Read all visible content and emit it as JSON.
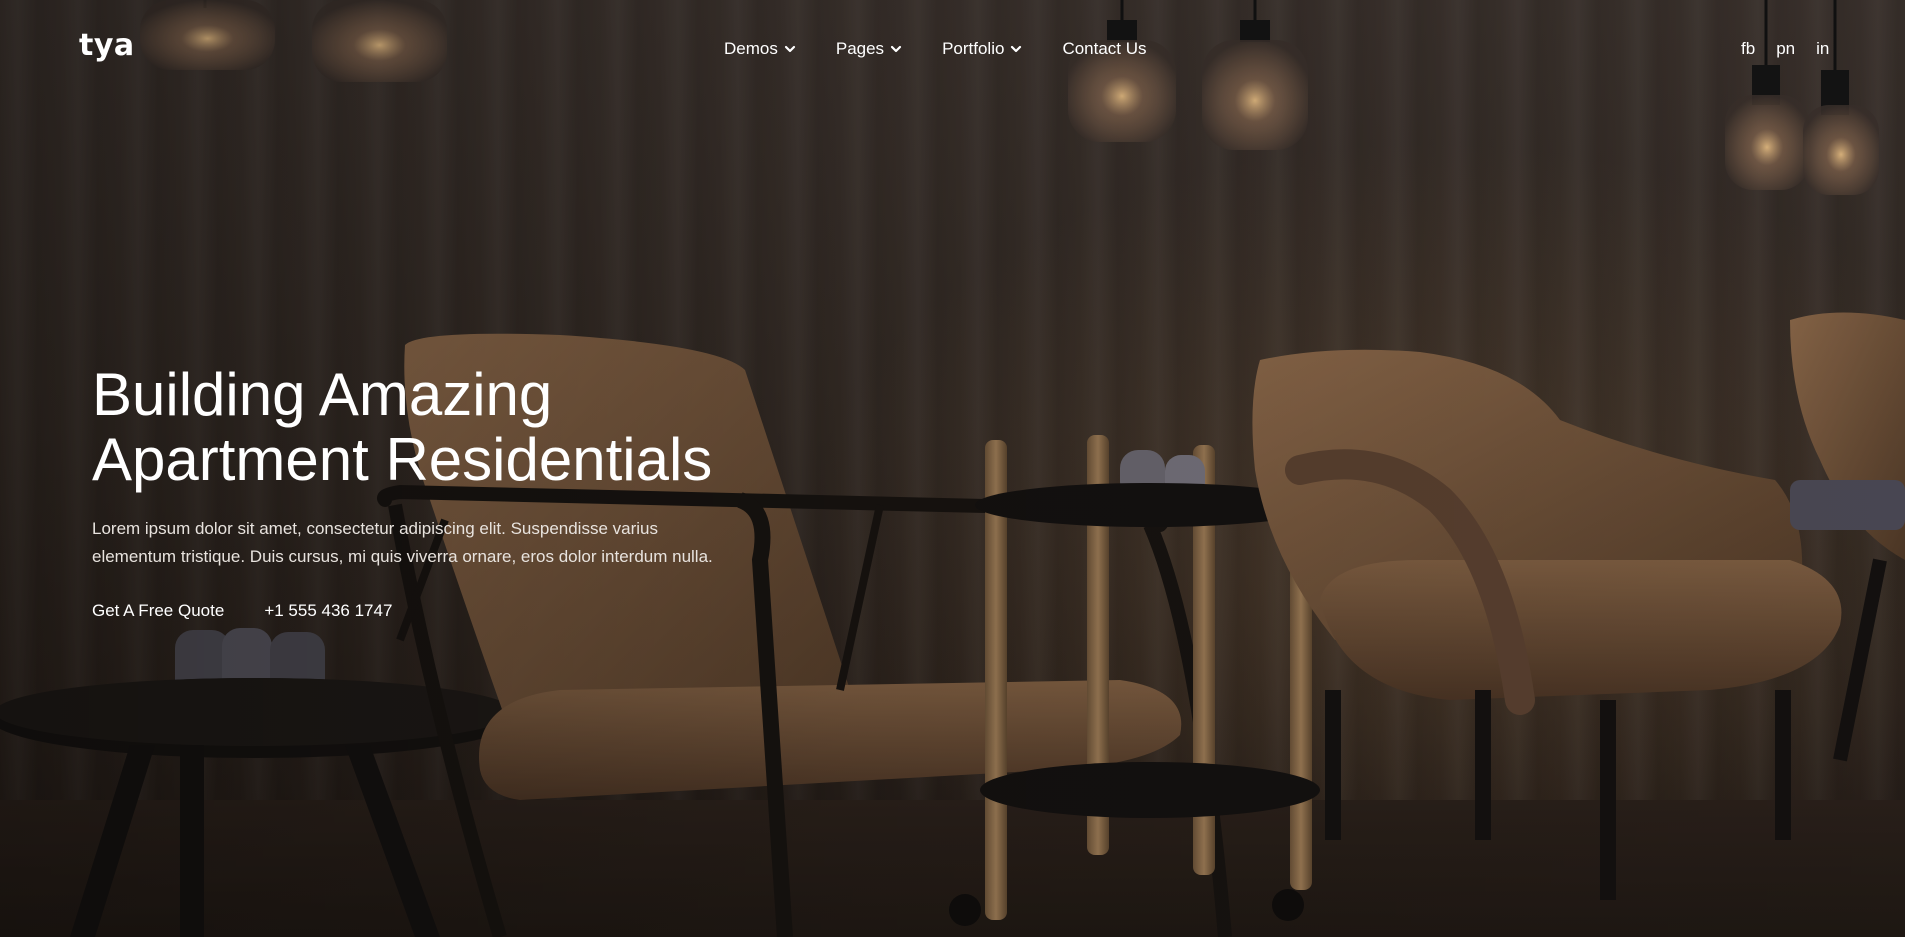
{
  "brand": {
    "logo_text": "tya"
  },
  "nav": {
    "items": [
      {
        "label": "Demos",
        "has_dropdown": true
      },
      {
        "label": "Pages",
        "has_dropdown": true
      },
      {
        "label": "Portfolio",
        "has_dropdown": true
      },
      {
        "label": "Contact Us",
        "has_dropdown": false
      }
    ]
  },
  "social": {
    "links": [
      {
        "label": "fb"
      },
      {
        "label": "pn"
      },
      {
        "label": "in"
      }
    ]
  },
  "hero": {
    "headline_line1": "Building Amazing",
    "headline_line2": "Apartment Residentials",
    "description": "Lorem ipsum dolor sit amet, consectetur adipiscing elit. Suspendisse varius elementum tristique. Duis cursus, mi quis viverra ornare, eros dolor interdum nulla.",
    "cta_label": "Get A Free Quote",
    "phone": "+1 555 436 1747"
  },
  "colors": {
    "text": "#ffffff",
    "muted_text": "#e8e3de",
    "chair_leather": "#7a5a3e",
    "background_dark": "#2a211b"
  }
}
